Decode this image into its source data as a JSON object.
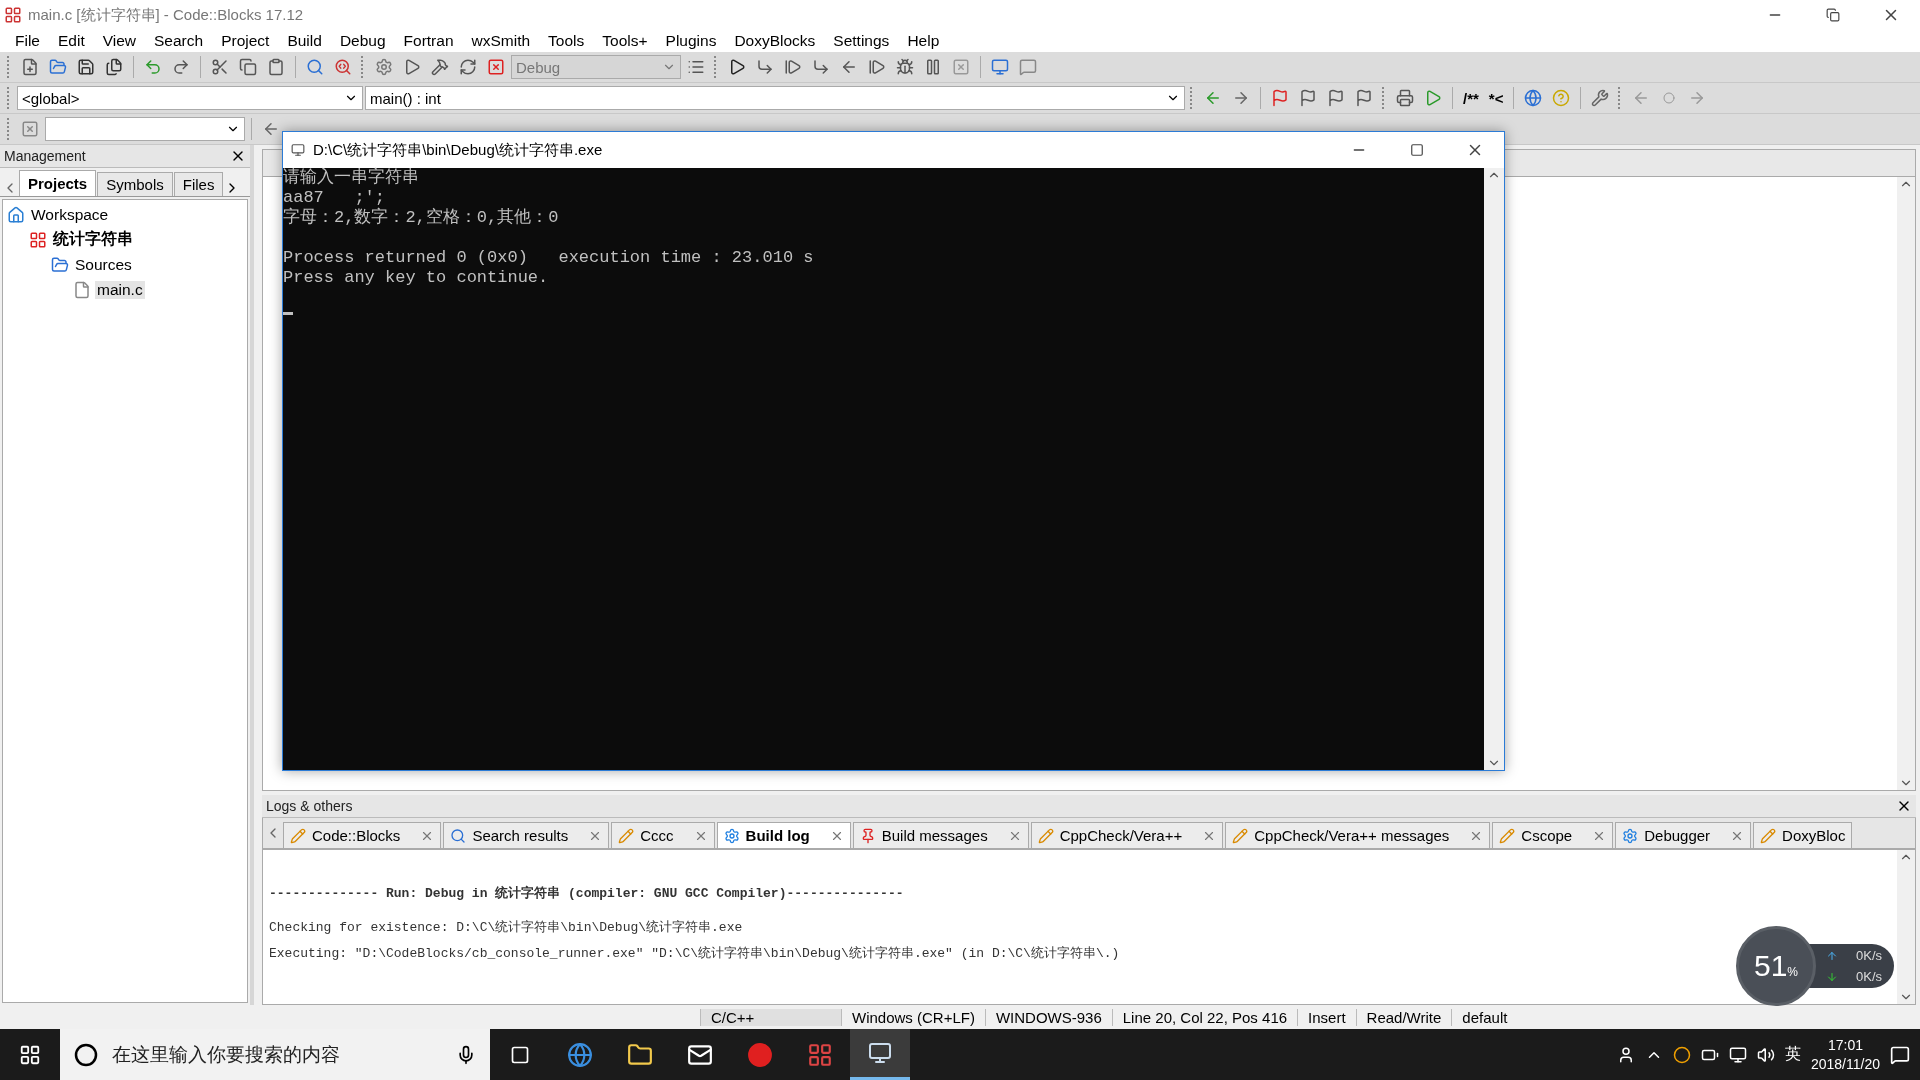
{
  "window": {
    "title": "main.c [统计字符串] - Code::Blocks 17.12"
  },
  "menu": [
    "File",
    "Edit",
    "View",
    "Search",
    "Project",
    "Build",
    "Debug",
    "Fortran",
    "wxSmith",
    "Tools",
    "Tools+",
    "Plugins",
    "DoxyBlocks",
    "Settings",
    "Help"
  ],
  "toolbar": {
    "build_target": "Debug",
    "scope": "<global>",
    "function": "main() : int",
    "doc_buttons": [
      "/**",
      "*<"
    ]
  },
  "management": {
    "title": "Management",
    "tabs": [
      {
        "label": "Projects",
        "selected": true
      },
      {
        "label": "Symbols",
        "selected": false
      },
      {
        "label": "Files",
        "selected": false
      }
    ],
    "tree": [
      {
        "label": "Workspace",
        "kind": "workspace",
        "children": [
          {
            "label": "统计字符串",
            "kind": "project",
            "children": [
              {
                "label": "Sources",
                "kind": "folder",
                "children": [
                  {
                    "label": "main.c",
                    "kind": "file",
                    "selected": true
                  }
                ]
              }
            ]
          }
        ]
      }
    ]
  },
  "console": {
    "title": "D:\\C\\统计字符串\\bin\\Debug\\统计字符串.exe",
    "blocks": [
      [
        "请输入一串字符串",
        "aa87   ;';",
        "字母：2,数字：2,空格：0,其他：0"
      ],
      [
        "Process returned 0 (0x0)   execution time : 23.010 s",
        "Press any key to continue."
      ]
    ]
  },
  "logs": {
    "title": "Logs & others",
    "tabs": [
      {
        "label": "Code::Blocks",
        "kind": "pencil",
        "selected": false
      },
      {
        "label": "Search results",
        "kind": "search",
        "selected": false
      },
      {
        "label": "Cccc",
        "kind": "pencil",
        "selected": false
      },
      {
        "label": "Build log",
        "kind": "gear",
        "selected": true
      },
      {
        "label": "Build messages",
        "kind": "pin",
        "selected": false
      },
      {
        "label": "CppCheck/Vera++",
        "kind": "pencil",
        "selected": false
      },
      {
        "label": "CppCheck/Vera++ messages",
        "kind": "pencil",
        "selected": false
      },
      {
        "label": "Cscope",
        "kind": "pencil",
        "selected": false
      },
      {
        "label": "Debugger",
        "kind": "gear",
        "selected": false
      },
      {
        "label": "DoxyBloc",
        "kind": "pencil",
        "selected": false
      }
    ],
    "lines": [
      {
        "kind": "header",
        "text": "-------------- Run: Debug in 统计字符串 (compiler: GNU GCC Compiler)---------------"
      },
      {
        "kind": "plain",
        "text": "Checking for existence: D:\\C\\统计字符串\\bin\\Debug\\统计字符串.exe"
      },
      {
        "kind": "plain",
        "text": "Executing: \"D:\\CodeBlocks/cb_console_runner.exe\" \"D:\\C\\统计字符串\\bin\\Debug\\统计字符串.exe\"  (in D:\\C\\统计字符串\\.)"
      }
    ]
  },
  "net_widget": {
    "percent": "51",
    "percent_sign": "%",
    "up": "0K/s",
    "down": "0K/s"
  },
  "status_bar": [
    "C/C++",
    "Windows (CR+LF)",
    "WINDOWS-936",
    "Line 20, Col 22, Pos 416",
    "Insert",
    "Read/Write",
    "default"
  ],
  "taskbar": {
    "search_placeholder": "在这里输入你要搜索的内容",
    "ime": "英",
    "time": "17:01",
    "date": "2018/11/20"
  }
}
